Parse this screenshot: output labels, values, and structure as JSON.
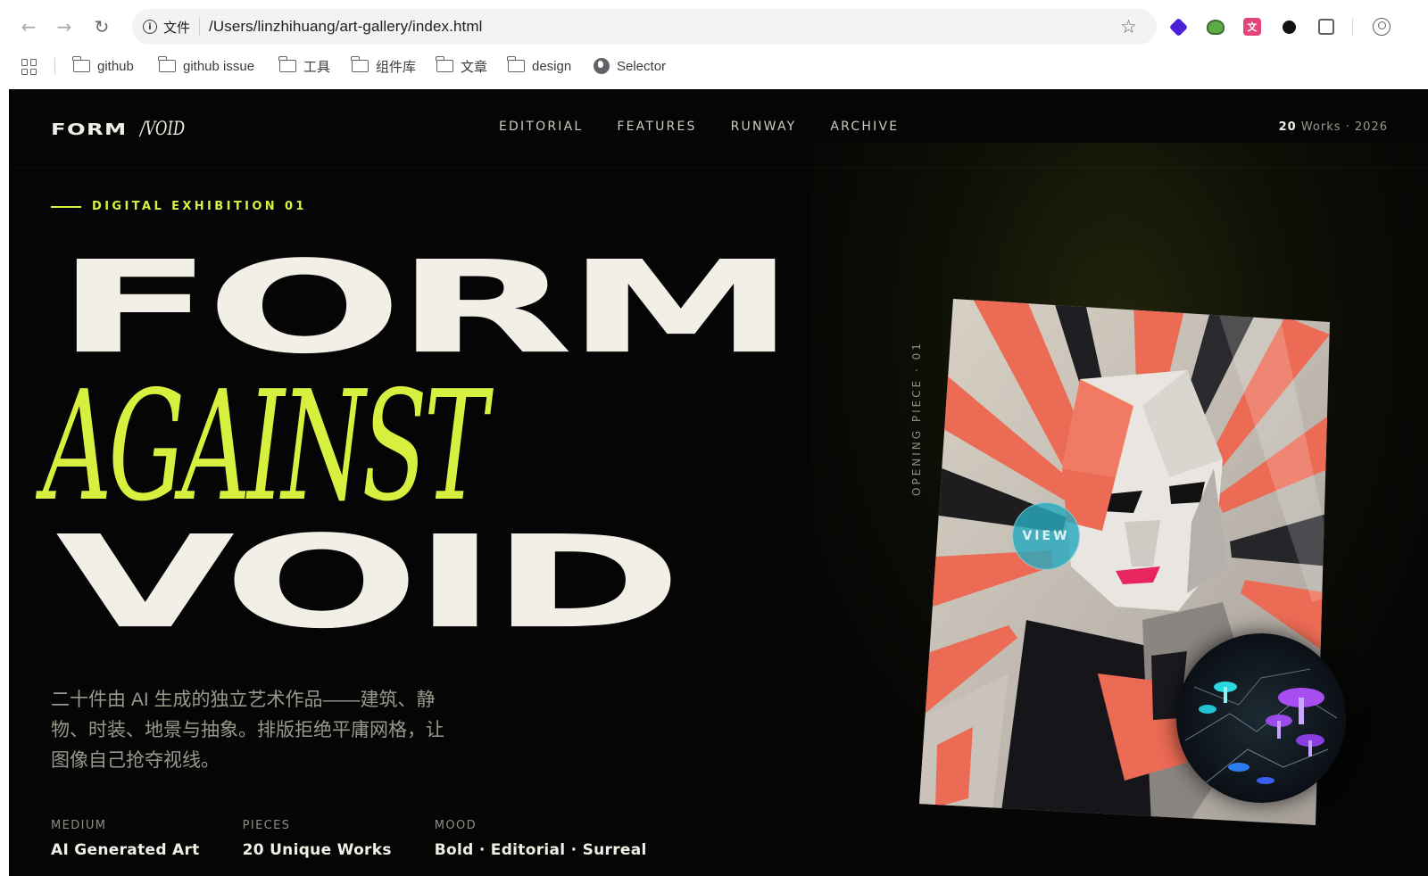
{
  "browser": {
    "nav": {
      "back_icon": "arrow-left-icon",
      "forward_icon": "arrow-right-icon",
      "reload_icon": "reload-icon"
    },
    "address": {
      "scheme_label": "文件",
      "url": "/Users/linzhihuang/art-gallery/index.html"
    },
    "bookmarks": [
      {
        "label": "github",
        "icon": "folder-icon"
      },
      {
        "label": "github issue",
        "icon": "folder-icon"
      },
      {
        "label": "工具",
        "icon": "folder-icon"
      },
      {
        "label": "组件库",
        "icon": "folder-icon"
      },
      {
        "label": "文章",
        "icon": "folder-icon"
      },
      {
        "label": "design",
        "icon": "folder-icon"
      },
      {
        "label": "Selector",
        "icon": "globe-icon"
      }
    ]
  },
  "site": {
    "logo": {
      "primary": "FORM",
      "secondary": "/VOID"
    },
    "nav": [
      {
        "label": "EDITORIAL"
      },
      {
        "label": "FEATURES"
      },
      {
        "label": "RUNWAY"
      },
      {
        "label": "ARCHIVE"
      }
    ],
    "meta": {
      "count": "20",
      "rest": "Works · 2026"
    }
  },
  "hero": {
    "eyebrow": "DIGITAL EXHIBITION 01",
    "line1": "FORM",
    "line2": "AGAINST",
    "line3": "VOID",
    "lead": "二十件由 AI 生成的独立艺术作品——建筑、静物、时装、地景与抽象。排版拒绝平庸网格，让图像自己抢夺视线。",
    "side_label": "OPENING PIECE · 01",
    "view_label": "VIEW",
    "stats": [
      {
        "label": "MEDIUM",
        "value": "AI Generated Art"
      },
      {
        "label": "PIECES",
        "value": "20 Unique Works"
      },
      {
        "label": "MOOD",
        "value": "Bold · Editorial · Surreal"
      }
    ]
  },
  "colors": {
    "accent": "#d7f040",
    "cream": "#f2efe6",
    "background": "#050505",
    "coral": "#ec6b55"
  }
}
